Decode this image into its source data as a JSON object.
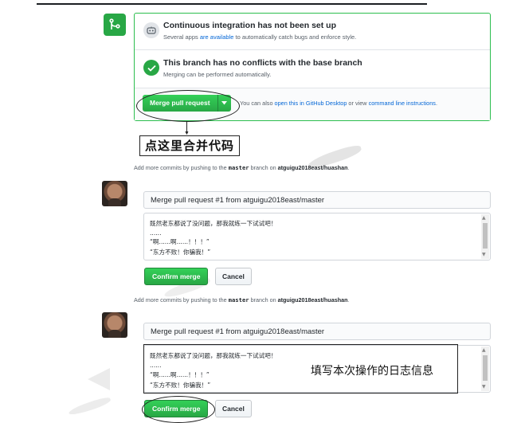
{
  "merge_panel": {
    "ci": {
      "title": "Continuous integration has not been set up",
      "sub_prefix": "Several apps ",
      "sub_link": "are available",
      "sub_suffix": " to automatically catch bugs and enforce style."
    },
    "conflicts": {
      "title": "This branch has no conflicts with the base branch",
      "sub": "Merging can be performed automatically."
    },
    "merge_button_label": "Merge pull request",
    "also_prefix": "You can also ",
    "desktop_link": "open this in GitHub Desktop",
    "also_mid": " or view ",
    "cli_link": "command line instructions",
    "also_suffix": "."
  },
  "annotation_click_here": "点这里合并代码",
  "hint": {
    "prefix": "Add more commits by pushing to the ",
    "branch": "master",
    "mid": " branch on ",
    "repo": "atguigu2018east/huashan",
    "suffix": "."
  },
  "commit_form_1": {
    "title_value": "Merge pull request #1 from atguigu2018east/master",
    "message_lines": [
      "既然老东都说了没问题，那我就练一下试试吧！",
      "......",
      "“啊......啊......！！！”",
      "“东方不败！你骗我！”"
    ],
    "confirm_label": "Confirm merge",
    "cancel_label": "Cancel"
  },
  "commit_form_2": {
    "title_value": "Merge pull request #1 from atguigu2018east/master",
    "message_lines": [
      "既然老东都说了没问题，那我就练一下试试吧！",
      "......",
      "“啊......啊......！！！”",
      "“东方不败！你骗我！”"
    ],
    "confirm_label": "Confirm merge",
    "cancel_label": "Cancel"
  },
  "annotation_log": "填写本次操作的日志信息",
  "colors": {
    "green": "#28a745",
    "link": "#0366d6",
    "border_green": "#2cbe4e"
  },
  "icons": [
    "git-merge-icon",
    "ci-icon",
    "check-icon",
    "caret-down-icon"
  ]
}
